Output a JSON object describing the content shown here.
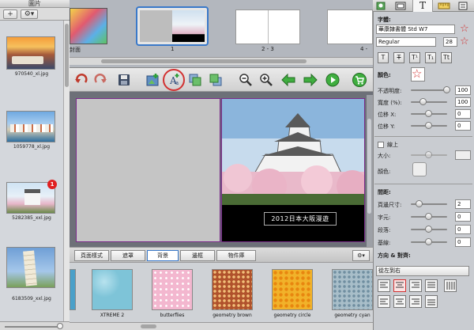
{
  "left_panel": {
    "title": "圖片",
    "add_label": "+",
    "gear_label": "⚙▾",
    "photos": [
      {
        "caption": "970540_xl.jpg"
      },
      {
        "caption": "1059778_xl.jpg"
      },
      {
        "caption": "5282385_xxl.jpg",
        "badge": "1"
      },
      {
        "caption": "6183509_xxl.jpg"
      }
    ]
  },
  "page_strip": {
    "pages": [
      {
        "caption": "封面"
      },
      {
        "caption": "1"
      },
      {
        "caption": "2 - 3"
      },
      {
        "caption": "4 -"
      }
    ]
  },
  "canvas": {
    "caption_text": "2012日本大阪漫遊"
  },
  "tabs": {
    "items": [
      {
        "label": "頁面樣式"
      },
      {
        "label": "遮罩"
      },
      {
        "label": "背景"
      },
      {
        "label": "邊框"
      },
      {
        "label": "物件庫"
      }
    ],
    "active": 2,
    "gear_label": "⚙▾"
  },
  "backgrounds": {
    "items": [
      {
        "caption": "XTREME 2",
        "color": "#7ec4d8"
      },
      {
        "caption": "butterflies",
        "color": "#f3b7cf"
      },
      {
        "caption": "geometry brown",
        "color": "#b0522c"
      },
      {
        "caption": "geometry circle",
        "color": "#f1b22a"
      },
      {
        "caption": "geometry cyan",
        "color": "#a8bec9"
      }
    ]
  },
  "inspector": {
    "font_label": "字體:",
    "font_value": "華康隸書體 Std W7",
    "style_value": "Regular",
    "size_value": "28",
    "style_buttons": [
      "T",
      "T",
      "T¹",
      "T₁",
      "Tt"
    ],
    "color_label": "顏色:",
    "opacity_label": "不透明度:",
    "opacity_value": "100",
    "width_label": "寬度 (%):",
    "width_value": "100",
    "posx_label": "位移 X:",
    "posx_value": "0",
    "posy_label": "位移 Y:",
    "posy_value": "0",
    "stroke_label": "線上",
    "size_label": "大小:",
    "stroke_color_label": "顏色:",
    "spacing_header": "間距:",
    "baseline_label": "頁邊尺寸:",
    "baseline_value": "2",
    "char_label": "字元:",
    "char_value": "0",
    "line_label": "段落:",
    "line_value": "0",
    "base_label": "基線:",
    "base_value": "0",
    "direction_header": "方向 & 對齊:",
    "direction_value": "從左到右"
  },
  "colors": {
    "accent_red": "#d23232",
    "selection_blue": "#3a79c9",
    "page_border": "#7a2a8a"
  }
}
